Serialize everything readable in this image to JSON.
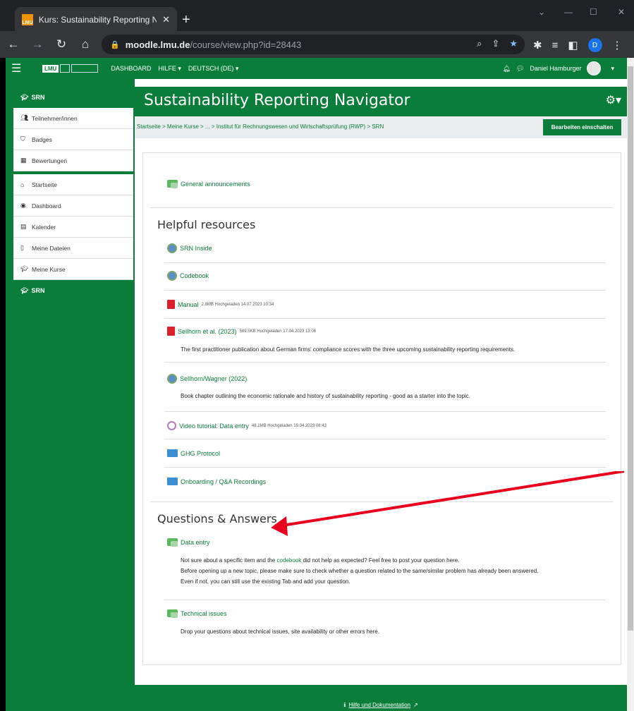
{
  "browser": {
    "tab_title": "Kurs: Sustainability Reporting Na",
    "favicon_text": "LMU",
    "url_host": "moodle.lmu.de",
    "url_path": "/course/view.php?id=28443",
    "profile_letter": "D"
  },
  "navbar": {
    "links": [
      "DASHBOARD",
      "HILFE ▾",
      "DEUTSCH (DE) ▾"
    ],
    "user_name": "Daniel Hamburger",
    "logo": "LMU"
  },
  "sidebar": {
    "course_block_title": "SRN",
    "course_items": [
      {
        "label": "Teilnehmer/innen",
        "icon": "users-icon"
      },
      {
        "label": "Badges",
        "icon": "shield-icon"
      },
      {
        "label": "Bewertungen",
        "icon": "table-icon"
      }
    ],
    "nav_items": [
      {
        "label": "Startseite",
        "icon": "home-icon"
      },
      {
        "label": "Dashboard",
        "icon": "dashboard-icon"
      },
      {
        "label": "Kalender",
        "icon": "calendar-icon"
      },
      {
        "label": "Meine Dateien",
        "icon": "file-icon"
      },
      {
        "label": "Meine Kurse",
        "icon": "graduation-cap-icon"
      }
    ],
    "active_item": "SRN"
  },
  "page": {
    "title": "Sustainability Reporting Navigator",
    "breadcrumb": "Startseite > Meine Kurse > ... > Institut für Rechnungswesen und Wirtschaftsprüfung (RWP) > SRN",
    "edit_button": "Bearbeiten einschalten"
  },
  "content": {
    "general_announcements": "General announcements",
    "helpful_resources_title": "Helpful resources",
    "srn_inside": "SRN Inside",
    "codebook": "Codebook",
    "manual": "Manual",
    "manual_meta": "2.8MB Hochgeladen 14.07.2023 10:34",
    "sellhorn": "Sellhorn et al. (2023)",
    "sellhorn_meta": "589.5KB Hochgeladen 17.04.2023 13:08",
    "sellhorn_desc": "The first practitioner publication about German firms' compliance scores with the three upcoming sustainability reporting requirements.",
    "sellhorn_wagner": "Sellhorn/Wagner (2022)",
    "sellhorn_wagner_desc": "Book chapter outlining the economic rationale and history of sustainability reporting - good as a starter into the topic.",
    "video": "Video tutorial: Data entry",
    "video_meta": "48.1MB Hochgeladen 19.04.2023 08:43",
    "ghg": "GHG Protocol",
    "onboarding": "Onboarding / Q&A Recordings",
    "qa_title": "Questions & Answers",
    "data_entry": "Data entry",
    "data_entry_desc1_pre": "Not sure about a specific item and the ",
    "data_entry_desc1_link": "codebook",
    "data_entry_desc1_post": " did not help as expected? Feel free to post your question here.",
    "data_entry_desc2": "Before opening up a new topic, please make sure to check whether a question related to the same/similar problem has already been answered.",
    "data_entry_desc3": "Even if not, you can still use the existing Tab and add your question.",
    "technical_issues": "Technical issues",
    "technical_issues_desc": "Drop your questions about technical issues, site availability or other errors here."
  },
  "footer": {
    "help_link": "Hilfe und Dokumentation"
  },
  "colors": {
    "brand_green": "#0a7d3b",
    "annotation_arrow": "#e8001c"
  }
}
